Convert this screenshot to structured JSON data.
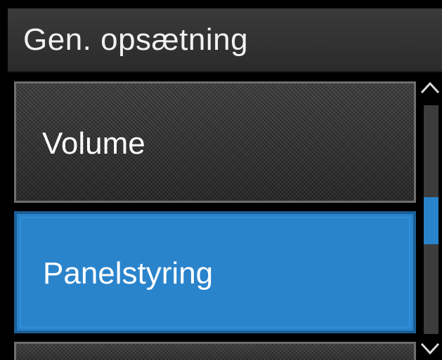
{
  "header": {
    "title": "Gen. opsætning"
  },
  "menu": {
    "items": [
      {
        "label": "Volume",
        "selected": false
      },
      {
        "label": "Panelstyring",
        "selected": true
      },
      {
        "label": "",
        "selected": false
      }
    ]
  },
  "scrollbar": {
    "up_icon": "chevron-up-icon",
    "down_icon": "chevron-down-icon",
    "position_fraction": 0.44
  },
  "colors": {
    "accent": "#2a84cc",
    "background": "#000000",
    "text": "#ffffff"
  }
}
